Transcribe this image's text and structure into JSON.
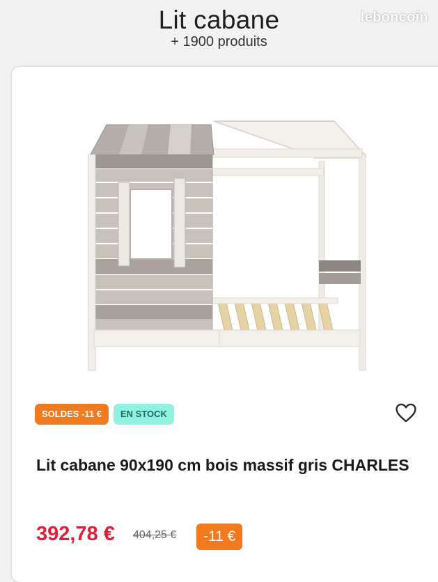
{
  "header": {
    "title": "Lit cabane",
    "subtitle": "+ 1900 produits",
    "watermark": "leboncoin"
  },
  "product": {
    "image_icon": "bunk-bed-cabin-image",
    "badges": {
      "sale": "SOLDES -11 €",
      "stock": "EN STOCK"
    },
    "favorite_icon": "heart-icon",
    "name": "Lit cabane 90x190 cm bois massif gris CHARLES",
    "price": "392,78 €",
    "old_price": "404,25 €",
    "discount": "-11 €"
  },
  "colors": {
    "sale_orange": "#f07a1d",
    "stock_mint": "#8ff2df",
    "price_red": "#e0203a"
  }
}
